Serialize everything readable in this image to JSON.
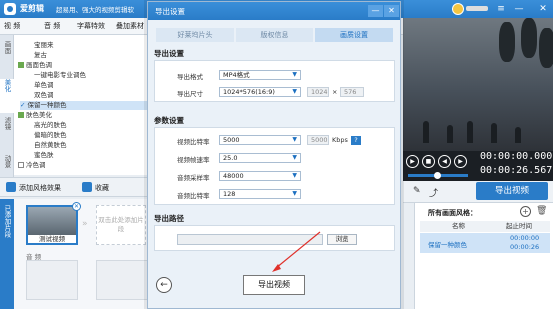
{
  "app": {
    "name": "爱剪辑",
    "slogan": "超易用、强大的视频剪辑软"
  },
  "menu": {
    "items": [
      "视 频",
      "音 频",
      "字幕特效",
      "叠加素材"
    ]
  },
  "left_tabs": [
    "画面",
    "美化",
    "滤镜",
    "动景"
  ],
  "effects": {
    "items": [
      {
        "label": "宝丽来",
        "indent": 2,
        "type": "item"
      },
      {
        "label": "复古",
        "indent": 2,
        "type": "item"
      },
      {
        "label": "画面色调",
        "indent": 0,
        "type": "group"
      },
      {
        "label": "一键电影专业调色",
        "indent": 2,
        "type": "item"
      },
      {
        "label": "单色调",
        "indent": 2,
        "type": "item"
      },
      {
        "label": "双色调",
        "indent": 2,
        "type": "item"
      },
      {
        "label": "保留一种颜色",
        "indent": 1,
        "type": "checked"
      },
      {
        "label": "肤色美化",
        "indent": 0,
        "type": "group"
      },
      {
        "label": "高光的肤色",
        "indent": 2,
        "type": "item"
      },
      {
        "label": "偏暗的肤色",
        "indent": 2,
        "type": "item"
      },
      {
        "label": "自然黄肤色",
        "indent": 2,
        "type": "item"
      },
      {
        "label": "蜜色肤",
        "indent": 2,
        "type": "item"
      },
      {
        "label": "冷色调",
        "indent": 0,
        "type": "group"
      }
    ],
    "add_button": "添加风格效果",
    "favorite_button": "收藏"
  },
  "timeline": {
    "side_label": "已添加片段",
    "clip_label": "测试视频",
    "drop_hint": "双击此处添加片段",
    "audio_track": "音 频"
  },
  "preview": {
    "time_current": "00:00:00.000",
    "time_total": "00:00:26.567",
    "export_button": "导出视频"
  },
  "style_panel": {
    "title": "所有画面风格：",
    "columns": [
      "名称",
      "起止时间"
    ],
    "rows": [
      {
        "name": "保留一种颜色",
        "start": "00:00:00",
        "end": "00:00:26"
      }
    ]
  },
  "dialog": {
    "title": "导出设置",
    "steps": [
      "好莱坞片头",
      "版权信息",
      "画质设置"
    ],
    "active_step": 2,
    "export_settings": {
      "section": "导出设置",
      "format_label": "导出格式",
      "format_value": "MP4格式",
      "size_label": "导出尺寸",
      "size_value": "1024*576(16:9)",
      "width": "1024",
      "times": "×",
      "height": "576"
    },
    "params": {
      "section": "参数设置",
      "video_bitrate_label": "视频比特率",
      "video_bitrate_value": "5000",
      "video_bitrate_custom": "5000",
      "bitrate_unit": "Kbps",
      "help": "?",
      "fps_label": "视频帧速率",
      "fps_value": "25.0",
      "audio_rate_label": "音频采样率",
      "audio_rate_value": "48000",
      "audio_bitrate_label": "音频比特率",
      "audio_bitrate_value": "128"
    },
    "path": {
      "section": "导出路径",
      "value": "",
      "browse": "浏览"
    },
    "back": "←",
    "export_button": "导出视频"
  }
}
